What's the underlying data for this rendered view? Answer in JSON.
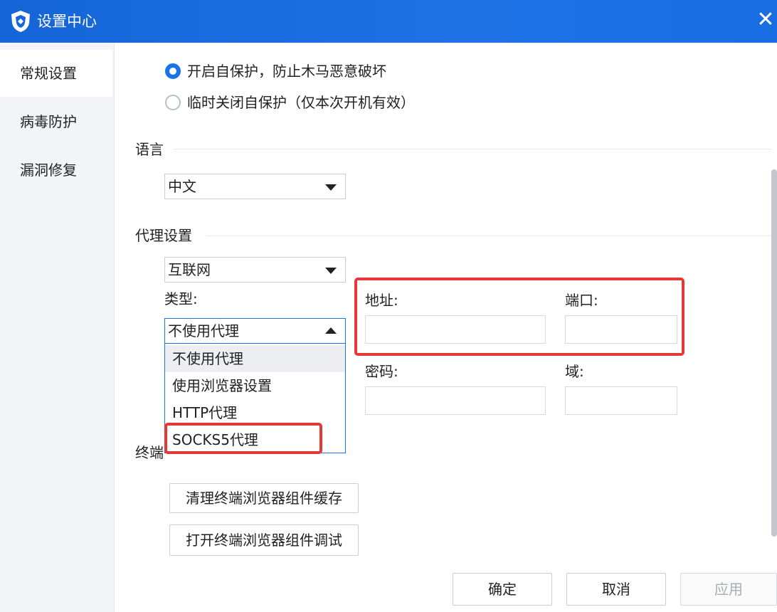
{
  "window": {
    "title": "设置中心",
    "close_glyph": "✕"
  },
  "sidebar": {
    "items": [
      {
        "label": "常规设置",
        "active": true
      },
      {
        "label": "病毒防护",
        "active": false
      },
      {
        "label": "漏洞修复",
        "active": false
      }
    ]
  },
  "self_protect": {
    "options": [
      {
        "label": "开启自保护，防止木马恶意破坏",
        "checked": true
      },
      {
        "label": "临时关闭自保护（仅本次开机有效）",
        "checked": false
      }
    ]
  },
  "language": {
    "section_title": "语言",
    "selected": "中文"
  },
  "proxy": {
    "section_title": "代理设置",
    "network_selected": "互联网",
    "type_label": "类型:",
    "type_selected": "不使用代理",
    "type_options": [
      "不使用代理",
      "使用浏览器设置",
      "HTTP代理",
      "SOCKS5代理"
    ],
    "address_label": "地址:",
    "port_label": "端口:",
    "password_label": "密码:",
    "domain_label": "域:",
    "address_value": "",
    "port_value": "",
    "password_value": "",
    "domain_value": ""
  },
  "terminal": {
    "section_title_partial": "终端",
    "clear_cache_label": "清理终端浏览器组件缓存",
    "open_debug_label": "打开终端浏览器组件调试"
  },
  "footer": {
    "ok_label": "确定",
    "cancel_label": "取消",
    "apply_label": "应用"
  },
  "colors": {
    "accent": "#1a73e8",
    "titlebar": "#1565d8",
    "highlight": "#e53935"
  },
  "icons": {
    "logo": "shield-logo-icon",
    "close": "close-icon",
    "dropdown": "caret-icon"
  }
}
